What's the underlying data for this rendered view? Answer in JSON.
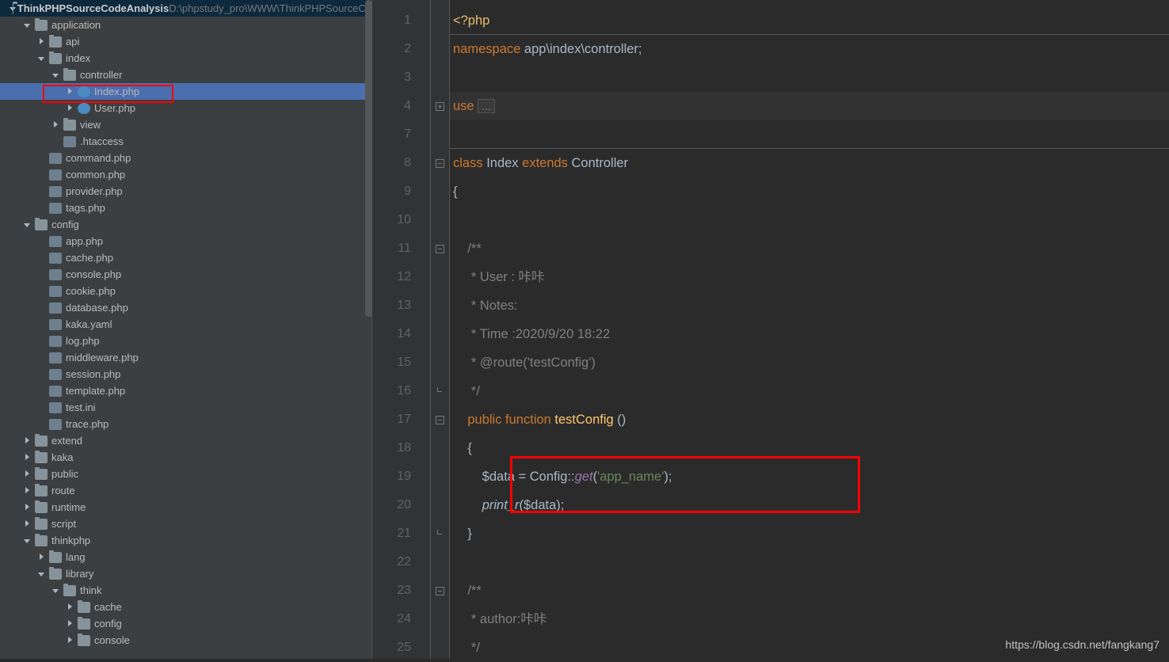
{
  "project": {
    "name": "ThinkPHPSourceCodeAnalysis",
    "path": "D:\\phpstudy_pro\\WWW\\ThinkPHPSourceCo"
  },
  "tree": [
    {
      "d": 0,
      "ch": "down",
      "ic": "folder",
      "lbl": "ThinkPHPSourceCodeAnalysis",
      "bold": true,
      "path": "D:\\phpstudy_pro\\WWW\\ThinkPHPSourceCo"
    },
    {
      "d": 1,
      "ch": "down",
      "ic": "folder-open",
      "lbl": "application"
    },
    {
      "d": 2,
      "ch": "right",
      "ic": "folder",
      "lbl": "api"
    },
    {
      "d": 2,
      "ch": "down",
      "ic": "folder-open",
      "lbl": "index"
    },
    {
      "d": 3,
      "ch": "down",
      "ic": "folder-open",
      "lbl": "controller"
    },
    {
      "d": 4,
      "ch": "right",
      "ic": "class",
      "lbl": "Index.php",
      "sel": true
    },
    {
      "d": 4,
      "ch": "right",
      "ic": "class",
      "lbl": "User.php"
    },
    {
      "d": 3,
      "ch": "right",
      "ic": "folder",
      "lbl": "view"
    },
    {
      "d": 3,
      "ch": "",
      "ic": "file",
      "lbl": ".htaccess"
    },
    {
      "d": 2,
      "ch": "",
      "ic": "php",
      "lbl": "command.php"
    },
    {
      "d": 2,
      "ch": "",
      "ic": "php",
      "lbl": "common.php"
    },
    {
      "d": 2,
      "ch": "",
      "ic": "php",
      "lbl": "provider.php"
    },
    {
      "d": 2,
      "ch": "",
      "ic": "php",
      "lbl": "tags.php"
    },
    {
      "d": 1,
      "ch": "down",
      "ic": "folder-open",
      "lbl": "config"
    },
    {
      "d": 2,
      "ch": "",
      "ic": "php",
      "lbl": "app.php"
    },
    {
      "d": 2,
      "ch": "",
      "ic": "php",
      "lbl": "cache.php"
    },
    {
      "d": 2,
      "ch": "",
      "ic": "php",
      "lbl": "console.php"
    },
    {
      "d": 2,
      "ch": "",
      "ic": "php",
      "lbl": "cookie.php"
    },
    {
      "d": 2,
      "ch": "",
      "ic": "php",
      "lbl": "database.php"
    },
    {
      "d": 2,
      "ch": "",
      "ic": "file",
      "lbl": "kaka.yaml"
    },
    {
      "d": 2,
      "ch": "",
      "ic": "php",
      "lbl": "log.php"
    },
    {
      "d": 2,
      "ch": "",
      "ic": "php",
      "lbl": "middleware.php"
    },
    {
      "d": 2,
      "ch": "",
      "ic": "php",
      "lbl": "session.php"
    },
    {
      "d": 2,
      "ch": "",
      "ic": "php",
      "lbl": "template.php"
    },
    {
      "d": 2,
      "ch": "",
      "ic": "file",
      "lbl": "test.ini"
    },
    {
      "d": 2,
      "ch": "",
      "ic": "php",
      "lbl": "trace.php"
    },
    {
      "d": 1,
      "ch": "right",
      "ic": "folder",
      "lbl": "extend"
    },
    {
      "d": 1,
      "ch": "right",
      "ic": "folder",
      "lbl": "kaka"
    },
    {
      "d": 1,
      "ch": "right",
      "ic": "folder",
      "lbl": "public"
    },
    {
      "d": 1,
      "ch": "right",
      "ic": "folder",
      "lbl": "route"
    },
    {
      "d": 1,
      "ch": "right",
      "ic": "folder",
      "lbl": "runtime"
    },
    {
      "d": 1,
      "ch": "right",
      "ic": "folder",
      "lbl": "script"
    },
    {
      "d": 1,
      "ch": "down",
      "ic": "folder-open",
      "lbl": "thinkphp"
    },
    {
      "d": 2,
      "ch": "right",
      "ic": "folder",
      "lbl": "lang"
    },
    {
      "d": 2,
      "ch": "down",
      "ic": "folder-open",
      "lbl": "library"
    },
    {
      "d": 3,
      "ch": "down",
      "ic": "folder-open",
      "lbl": "think"
    },
    {
      "d": 4,
      "ch": "right",
      "ic": "folder",
      "lbl": "cache"
    },
    {
      "d": 4,
      "ch": "right",
      "ic": "folder",
      "lbl": "config"
    },
    {
      "d": 4,
      "ch": "right",
      "ic": "folder",
      "lbl": "console"
    }
  ],
  "gutter": [
    "1",
    "2",
    "3",
    "4",
    "7",
    "8",
    "9",
    "10",
    "11",
    "12",
    "13",
    "14",
    "15",
    "16",
    "17",
    "18",
    "19",
    "20",
    "21",
    "22",
    "23",
    "24",
    "25"
  ],
  "code": {
    "l1": {
      "a": "<?php"
    },
    "l2": {
      "a": "namespace",
      "b": " app\\index\\controller;"
    },
    "l4": {
      "a": "use ",
      "b": "..."
    },
    "l8": {
      "a": "class ",
      "b": "Index ",
      "c": "extends ",
      "d": "Controller"
    },
    "l9": {
      "a": "{"
    },
    "l11": {
      "a": "    /**"
    },
    "l12": {
      "a": "     * User : 咔咔"
    },
    "l13": {
      "a": "     * Notes:"
    },
    "l14": {
      "a": "     * Time :2020/9/20 18:22"
    },
    "l15": {
      "a": "     * @route('testConfig')"
    },
    "l16": {
      "a": "     */"
    },
    "l17": {
      "a": "    public ",
      "b": "function ",
      "c": "testConfig ",
      "d": "()"
    },
    "l18": {
      "a": "    {"
    },
    "l19": {
      "a": "        $data = Config::",
      "b": "get",
      "c": "(",
      "d": "'app_name'",
      "e": ");"
    },
    "l20": {
      "a": "        ",
      "b": "print_r",
      "c": "($data);"
    },
    "l21": {
      "a": "    }"
    },
    "l23": {
      "a": "    /**"
    },
    "l24": {
      "a": "     * author:咔咔"
    },
    "l25": {
      "a": "     */"
    }
  },
  "watermark": "https://blog.csdn.net/fangkang7"
}
